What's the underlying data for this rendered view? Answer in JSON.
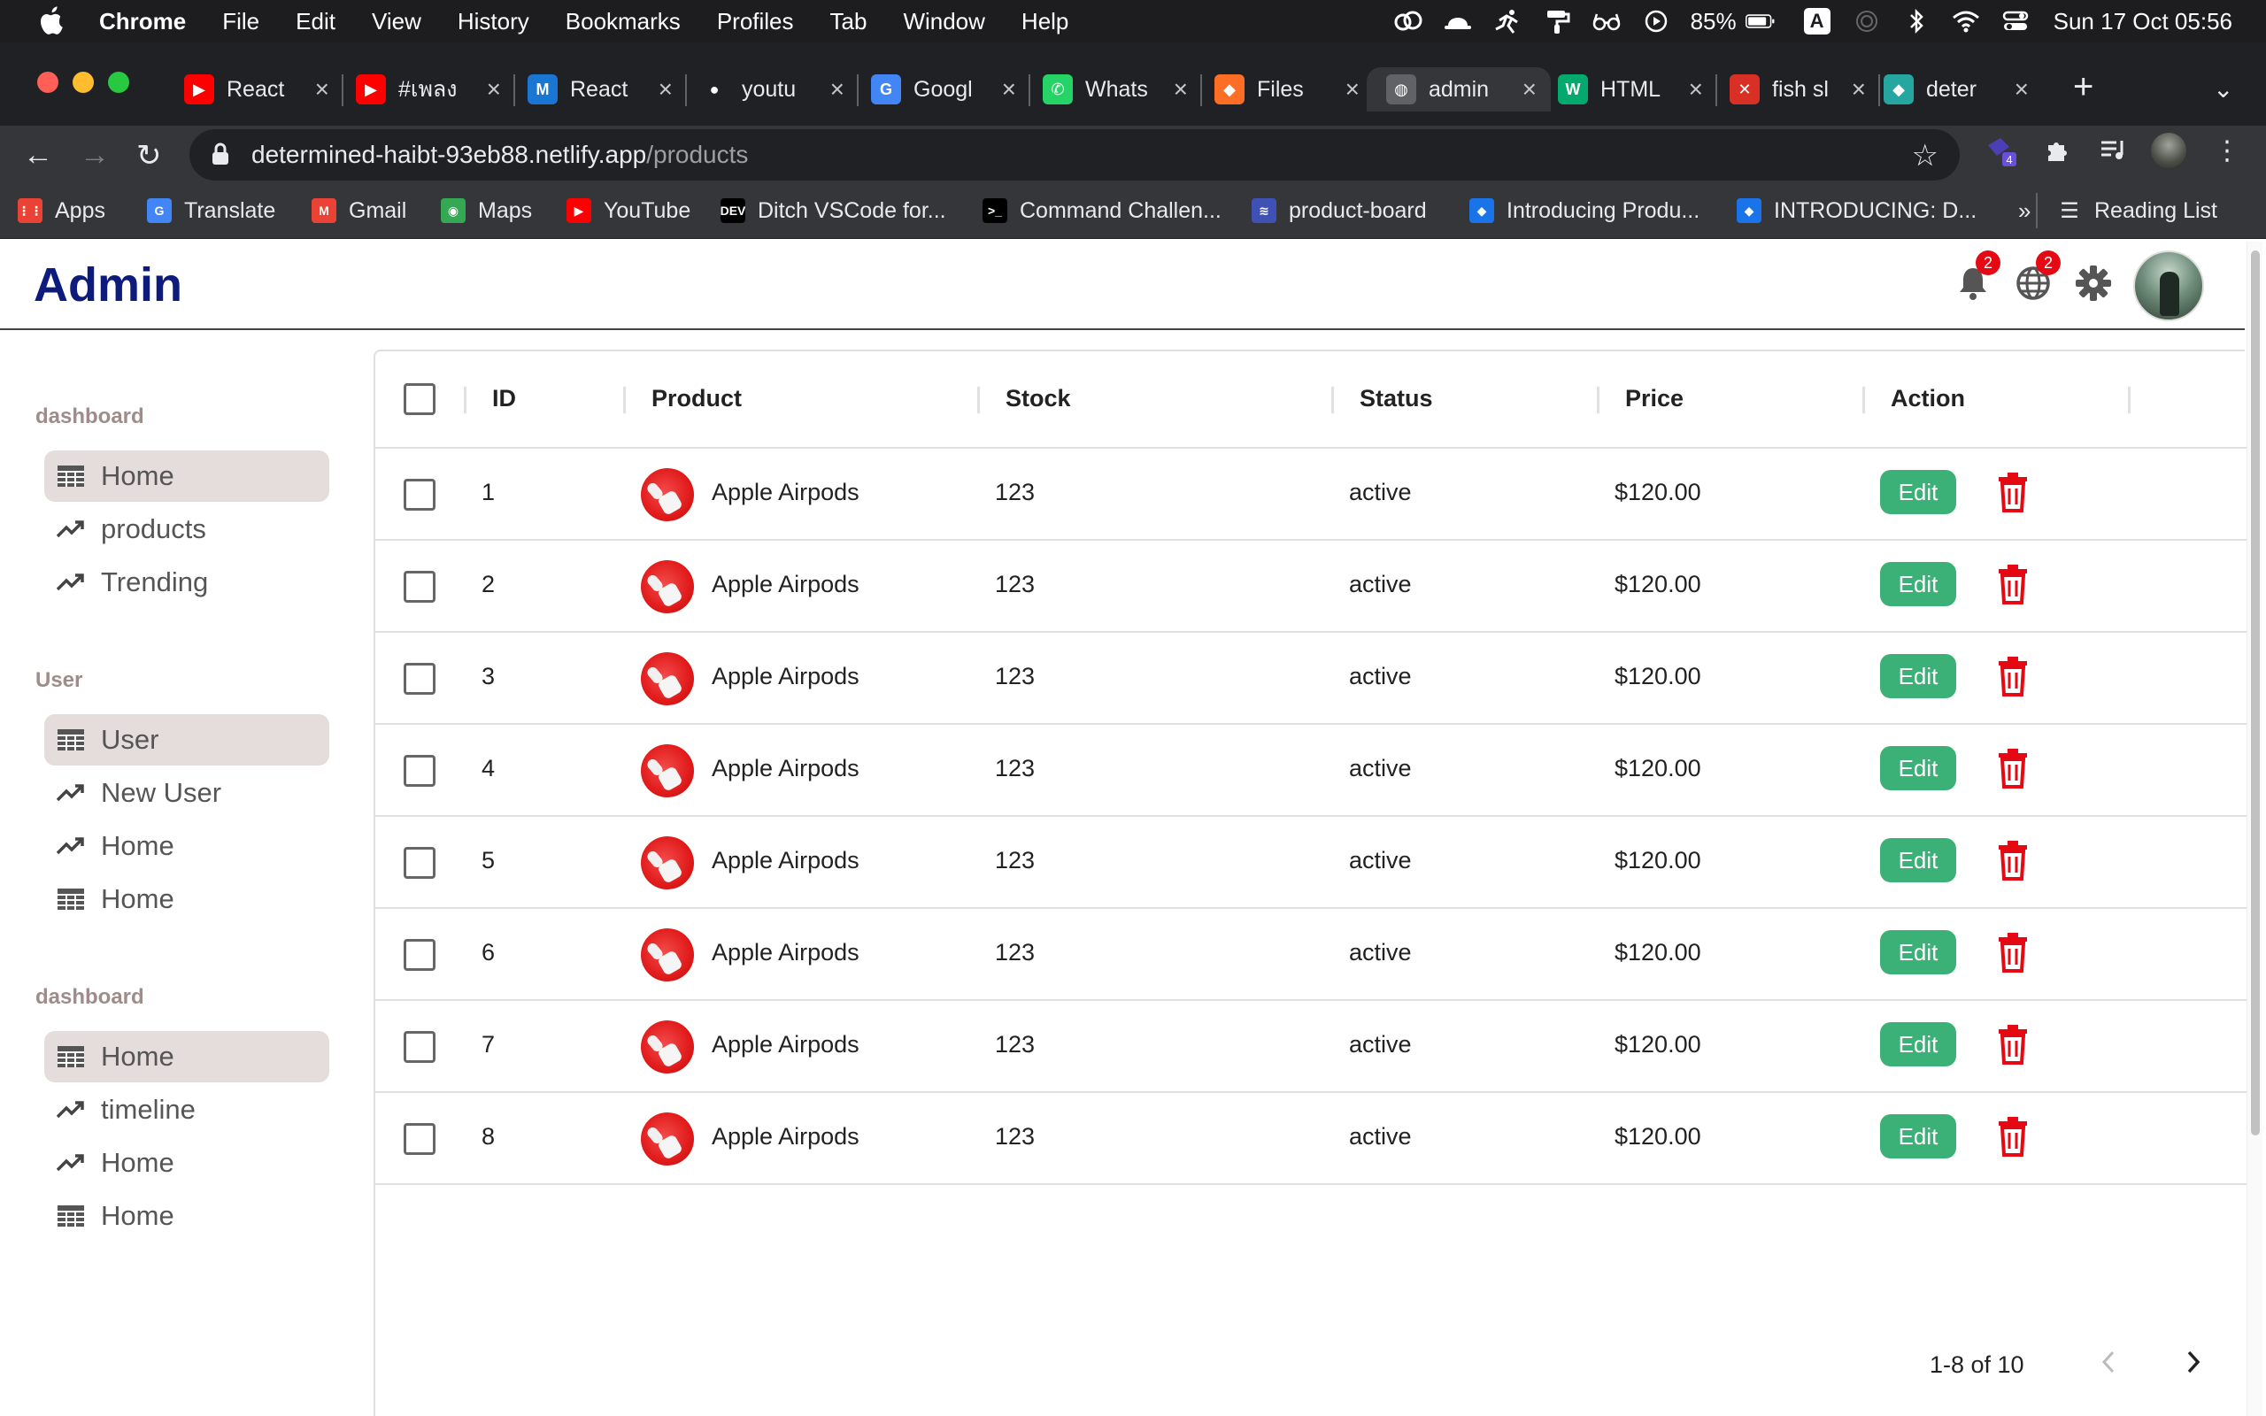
{
  "menubar": {
    "app": "Chrome",
    "menus": [
      "File",
      "Edit",
      "View",
      "History",
      "Bookmarks",
      "Profiles",
      "Tab",
      "Window",
      "Help"
    ],
    "battery": "85%",
    "input_source": "A",
    "clock": "Sun 17 Oct  05:56"
  },
  "tabs": [
    {
      "title": "React",
      "icon": "youtube-icon",
      "color": "#ff0000",
      "glyph": "▶"
    },
    {
      "title": "#เพลง",
      "icon": "youtube-icon",
      "color": "#ff0000",
      "glyph": "▶"
    },
    {
      "title": "React",
      "icon": "mui-icon",
      "color": "#1976d2",
      "glyph": "M"
    },
    {
      "title": "youtu",
      "icon": "github-icon",
      "color": "#202124",
      "glyph": "●"
    },
    {
      "title": "Googl",
      "icon": "google-translate-icon",
      "color": "#4285f4",
      "glyph": "G"
    },
    {
      "title": "Whats",
      "icon": "whatsapp-icon",
      "color": "#25d366",
      "glyph": "✆"
    },
    {
      "title": "Files",
      "icon": "gitlab-icon",
      "color": "#fc6d26",
      "glyph": "◆"
    },
    {
      "title": "admin",
      "icon": "globe-icon",
      "color": "#5f6368",
      "glyph": "◍",
      "active": true
    },
    {
      "title": "HTML",
      "icon": "w3schools-icon",
      "color": "#04aa6d",
      "glyph": "W"
    },
    {
      "title": "fish sl",
      "icon": "codepen-icon",
      "color": "#d93025",
      "glyph": "✕"
    },
    {
      "title": "deter",
      "icon": "netlify-icon",
      "color": "#25a6a0",
      "glyph": "◆"
    }
  ],
  "address": {
    "host": "determined-haibt-93eb88.netlify.app",
    "path": "/products"
  },
  "extension_badge": "4",
  "bookmarks": [
    {
      "label": "Apps",
      "icon": "apps-grid-icon",
      "color": "#ea4335",
      "glyph": "⋮⋮"
    },
    {
      "label": "Translate",
      "icon": "google-translate-icon",
      "color": "#4285f4",
      "glyph": "G"
    },
    {
      "label": "Gmail",
      "icon": "gmail-icon",
      "color": "#ea4335",
      "glyph": "M"
    },
    {
      "label": "Maps",
      "icon": "maps-icon",
      "color": "#34a853",
      "glyph": "◉"
    },
    {
      "label": "YouTube",
      "icon": "youtube-icon",
      "color": "#ff0000",
      "glyph": "▶"
    },
    {
      "label": "Ditch VSCode for...",
      "icon": "dev-icon",
      "color": "#000000",
      "glyph": "DEV"
    },
    {
      "label": "Command Challen...",
      "icon": "terminal-icon",
      "color": "#000000",
      "glyph": ">_"
    },
    {
      "label": "product-board",
      "icon": "stack-icon",
      "color": "#3f51b5",
      "glyph": "≋"
    },
    {
      "label": "Introducing Produ...",
      "icon": "diamond-icon",
      "color": "#1a73e8",
      "glyph": "◆"
    },
    {
      "label": "INTRODUCING: D...",
      "icon": "diamond-icon",
      "color": "#1a73e8",
      "glyph": "◆"
    }
  ],
  "bookmarks_overflow": "»",
  "reading_list": "Reading List",
  "app": {
    "logo": "Admin",
    "notifications_count": "2",
    "language_count": "2"
  },
  "sidebar": {
    "sections": [
      {
        "title": "dashboard",
        "items": [
          {
            "label": "Home",
            "icon": "table-icon",
            "selected": true
          },
          {
            "label": "products",
            "icon": "trending-icon"
          },
          {
            "label": "Trending",
            "icon": "trending-icon"
          }
        ]
      },
      {
        "title": "User",
        "items": [
          {
            "label": "User",
            "icon": "table-icon",
            "selected": true
          },
          {
            "label": "New User",
            "icon": "trending-icon"
          },
          {
            "label": "Home",
            "icon": "trending-icon"
          },
          {
            "label": "Home",
            "icon": "table-icon"
          }
        ]
      },
      {
        "title": "dashboard",
        "items": [
          {
            "label": "Home",
            "icon": "table-icon",
            "selected": true
          },
          {
            "label": "timeline",
            "icon": "trending-icon"
          },
          {
            "label": "Home",
            "icon": "trending-icon"
          },
          {
            "label": "Home",
            "icon": "table-icon"
          }
        ]
      }
    ]
  },
  "table": {
    "columns": [
      "ID",
      "Product",
      "Stock",
      "Status",
      "Price",
      "Action"
    ],
    "rows": [
      {
        "id": "1",
        "product": "Apple Airpods",
        "stock": "123",
        "status": "active",
        "price": "$120.00"
      },
      {
        "id": "2",
        "product": "Apple Airpods",
        "stock": "123",
        "status": "active",
        "price": "$120.00"
      },
      {
        "id": "3",
        "product": "Apple Airpods",
        "stock": "123",
        "status": "active",
        "price": "$120.00"
      },
      {
        "id": "4",
        "product": "Apple Airpods",
        "stock": "123",
        "status": "active",
        "price": "$120.00"
      },
      {
        "id": "5",
        "product": "Apple Airpods",
        "stock": "123",
        "status": "active",
        "price": "$120.00"
      },
      {
        "id": "6",
        "product": "Apple Airpods",
        "stock": "123",
        "status": "active",
        "price": "$120.00"
      },
      {
        "id": "7",
        "product": "Apple Airpods",
        "stock": "123",
        "status": "active",
        "price": "$120.00"
      },
      {
        "id": "8",
        "product": "Apple Airpods",
        "stock": "123",
        "status": "active",
        "price": "$120.00"
      }
    ],
    "edit_label": "Edit",
    "pagination": "1-8 of 10"
  },
  "colors": {
    "accent_green": "#3bb077",
    "delete_red": "#e50914",
    "logo_navy": "#0d1b7d",
    "selected_bg": "#e5dcdc"
  }
}
